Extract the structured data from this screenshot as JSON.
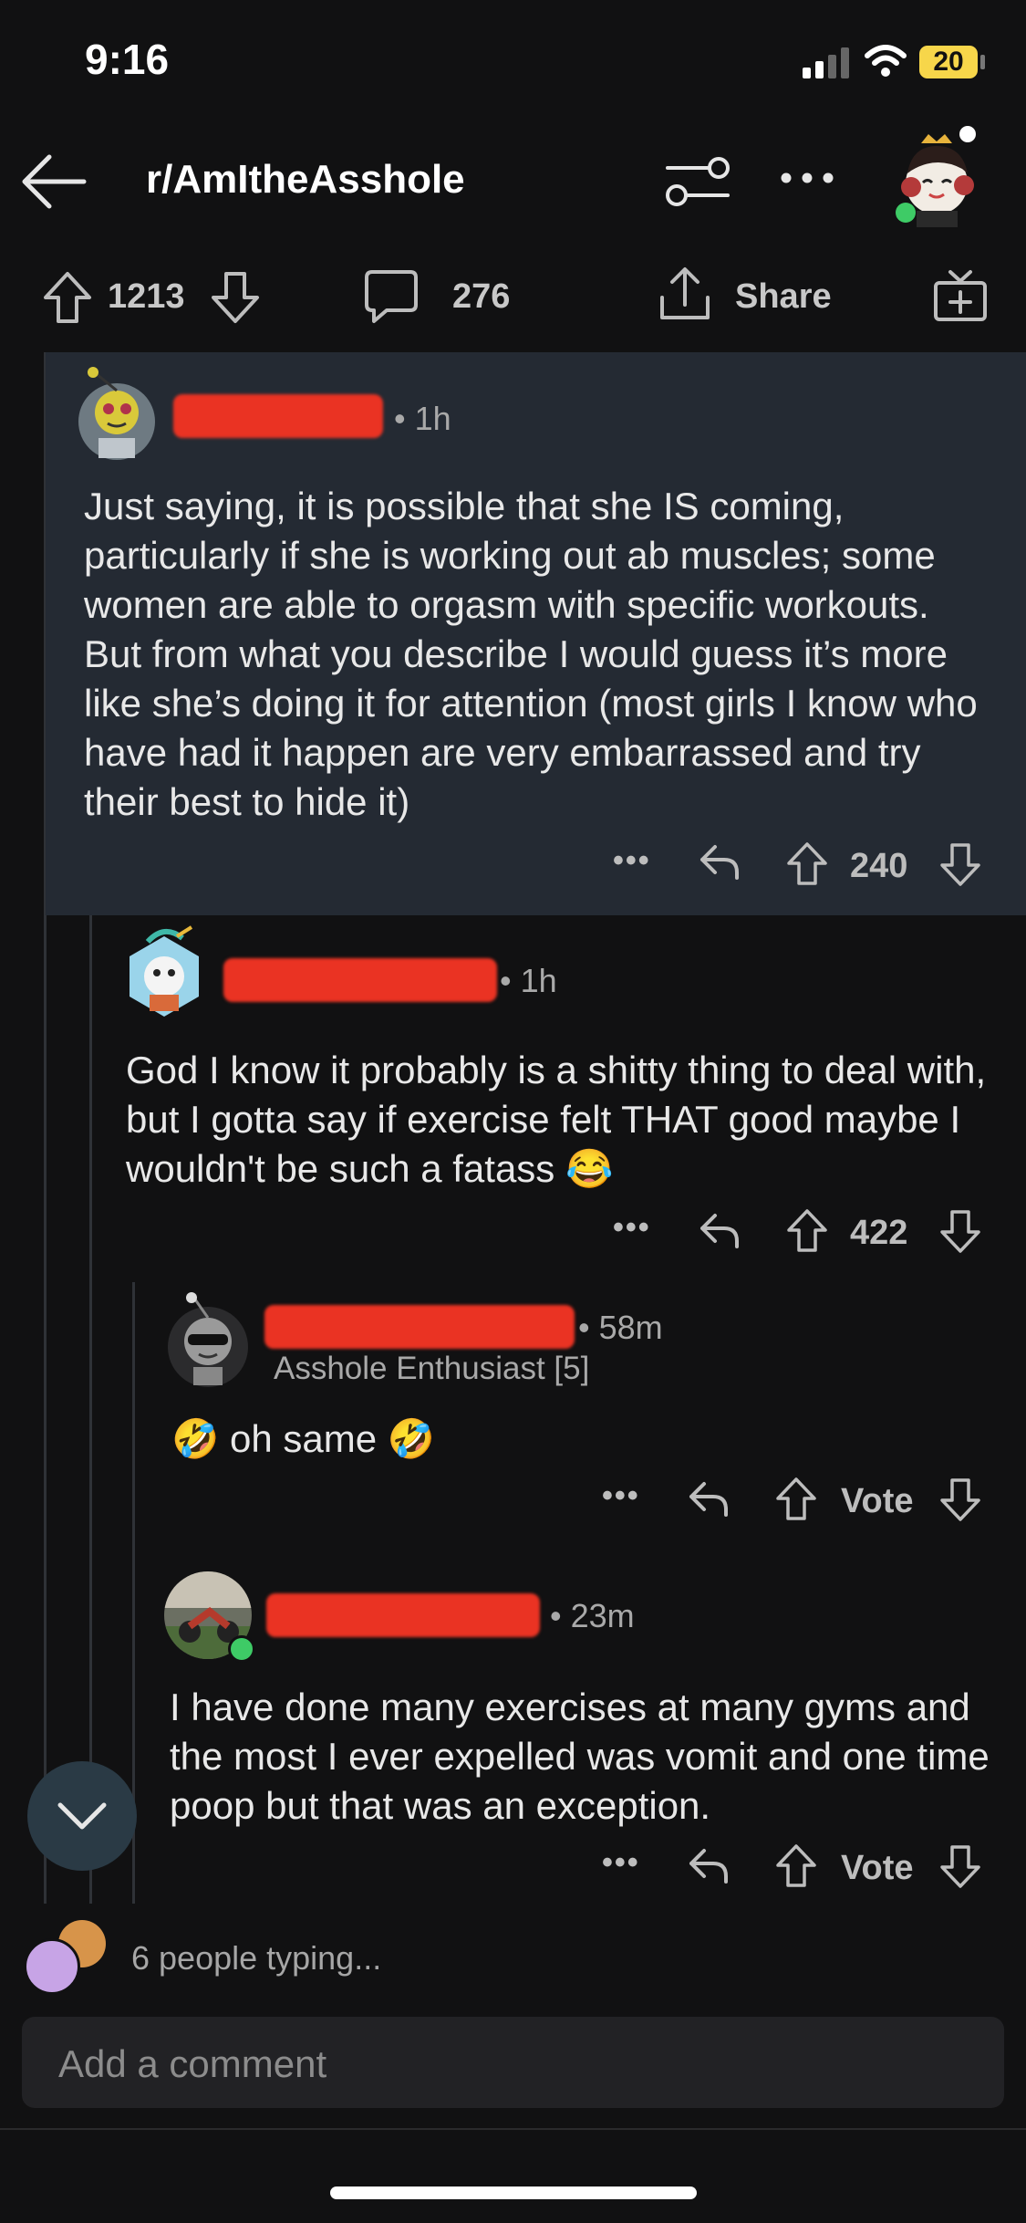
{
  "status": {
    "time": "9:16",
    "battery": "20"
  },
  "header": {
    "subreddit": "r/AmItheAsshole"
  },
  "post_actions": {
    "upvotes": "1213",
    "comments": "276",
    "share_label": "Share"
  },
  "comments": [
    {
      "time": "• 1h",
      "body": "Just saying, it is possible that she IS coming, particularly if she is working out ab muscles; some women are able to orgasm with specific workouts. But from what you describe I would guess it’s more like she’s doing it for attention (most girls I know who have  had it happen are very embarrassed and try their best to hide it)",
      "score": "240"
    },
    {
      "time": "• 1h",
      "body": "God I know it probably is a shitty thing to deal with, but I gotta say if exercise felt THAT good maybe I wouldn't be such a fatass 😂",
      "score": "422"
    },
    {
      "time": "• 58m",
      "flair": "Asshole Enthusiast [5]",
      "body": "🤣 oh same 🤣",
      "score": "Vote"
    },
    {
      "time": "• 23m",
      "body": "I have done many exercises at many gyms and the most I ever expelled was vomit and one time poop but that was an exception.",
      "score": "Vote"
    }
  ],
  "footer": {
    "typing": "6 people typing...",
    "comment_placeholder": "Add a comment"
  }
}
